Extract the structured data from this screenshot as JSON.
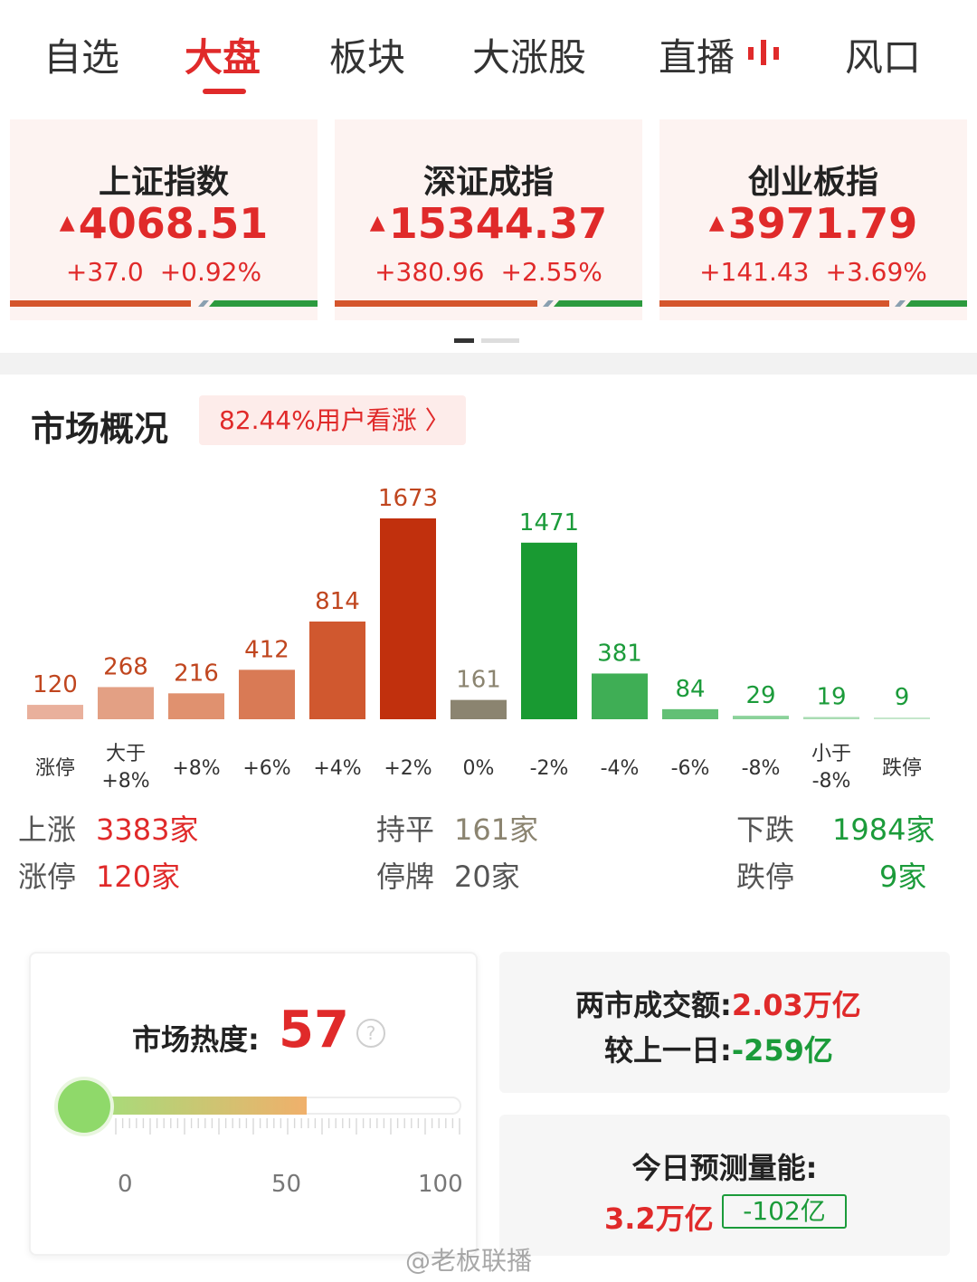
{
  "tabs": [
    "自选",
    "大盘",
    "板块",
    "大涨股",
    "直播",
    "风口"
  ],
  "active_tab": "大盘",
  "indices": [
    {
      "name": "上证指数",
      "value": "4068.51",
      "change": "+37.0",
      "pct": "+0.92%"
    },
    {
      "name": "深证成指",
      "value": "15344.37",
      "change": "+380.96",
      "pct": "+2.55%"
    },
    {
      "name": "创业板指",
      "value": "3971.79",
      "change": "+141.43",
      "pct": "+3.69%"
    }
  ],
  "overview": {
    "title": "市场概况",
    "sentiment": "82.44%用户看涨 〉"
  },
  "chart_data": {
    "type": "bar",
    "categories": [
      "涨停",
      "大于\n+8%",
      "+8%",
      "+6%",
      "+4%",
      "+2%",
      "0%",
      "-2%",
      "-4%",
      "-6%",
      "-8%",
      "小于\n-8%",
      "跌停"
    ],
    "values": [
      120,
      268,
      216,
      412,
      814,
      1673,
      161,
      1471,
      381,
      84,
      29,
      19,
      9
    ],
    "colors": [
      "#e9b09c",
      "#e3a084",
      "#e0916f",
      "#d97a55",
      "#d0582f",
      "#c1300d",
      "#8b8470",
      "#199a32",
      "#3fae55",
      "#62c075",
      "#8bd29a",
      "#a9dcb3",
      "#c5e7cc"
    ],
    "label_colors": [
      "#c0461f",
      "#c0461f",
      "#c0461f",
      "#c0461f",
      "#c0461f",
      "#c0461f",
      "#8b8470",
      "#1b9b3a",
      "#1b9b3a",
      "#1b9b3a",
      "#1b9b3a",
      "#1b9b3a",
      "#1b9b3a"
    ]
  },
  "stats": {
    "up_label": "上涨",
    "up_value": "3383家",
    "flat_label": "持平",
    "flat_value": "161家",
    "down_label": "下跌",
    "down_value": "1984家",
    "limit_up_label": "涨停",
    "limit_up_value": "120家",
    "suspended_label": "停牌",
    "suspended_value": "20家",
    "limit_down_label": "跌停",
    "limit_down_value": "9家"
  },
  "heat": {
    "label": "市场热度:",
    "value": "57",
    "level": 57,
    "scale": [
      "0",
      "50",
      "100"
    ]
  },
  "turnover": {
    "label": "两市成交额:",
    "value": "2.03万亿",
    "compare_label": "较上一日:",
    "compare_value": "-259亿"
  },
  "forecast": {
    "title": "今日预测量能:",
    "value": "3.2万亿",
    "delta": "-102亿"
  },
  "watermark": "@老板联播",
  "colors": {
    "red": "#e02a2a",
    "green": "#1b9b3a"
  }
}
